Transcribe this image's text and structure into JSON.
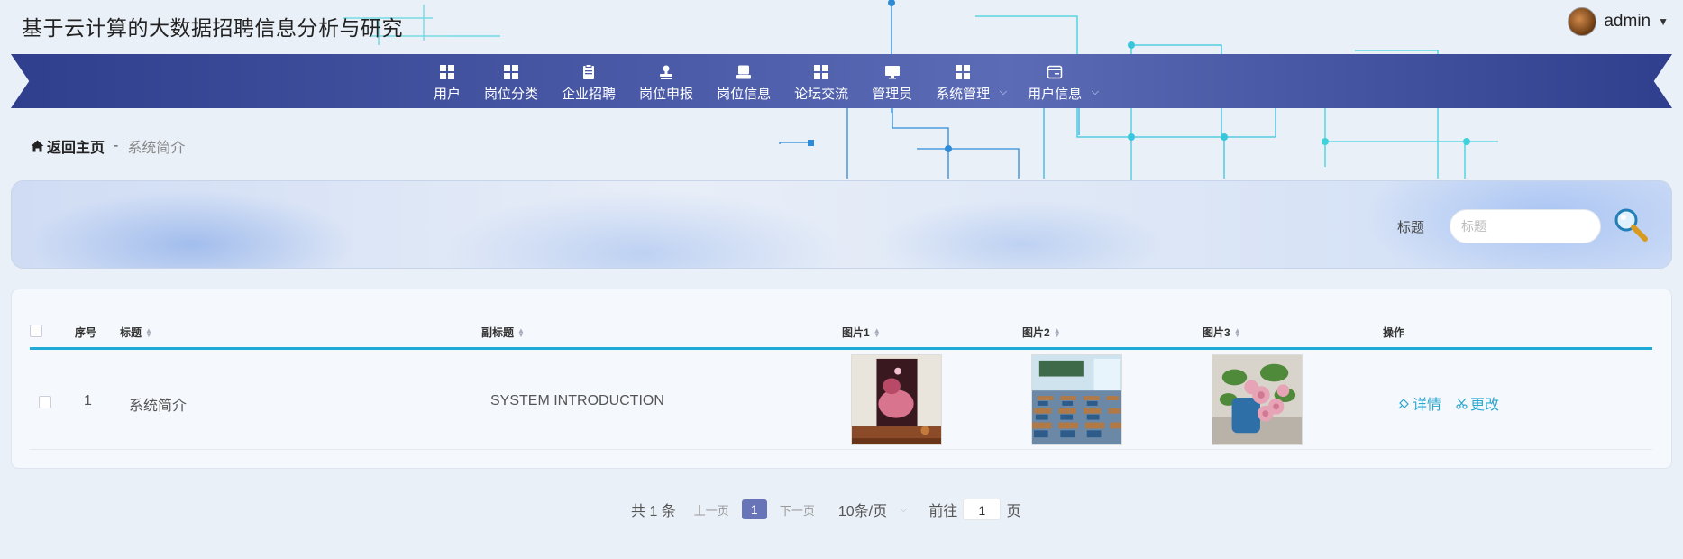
{
  "app": {
    "title": "基于云计算的大数据招聘信息分析与研究"
  },
  "user": {
    "name": "admin"
  },
  "nav": {
    "items": [
      {
        "label": "用户",
        "icon": "grid-icon"
      },
      {
        "label": "岗位分类",
        "icon": "grid-icon"
      },
      {
        "label": "企业招聘",
        "icon": "clipboard-icon"
      },
      {
        "label": "岗位申报",
        "icon": "stamp-icon"
      },
      {
        "label": "岗位信息",
        "icon": "inbox-icon"
      },
      {
        "label": "论坛交流",
        "icon": "grid-icon"
      },
      {
        "label": "管理员",
        "icon": "monitor-icon"
      },
      {
        "label": "系统管理",
        "icon": "grid-icon",
        "dropdown": true
      },
      {
        "label": "用户信息",
        "icon": "card-icon",
        "dropdown": true
      }
    ]
  },
  "breadcrumb": {
    "home": "返回主页",
    "separator": "-",
    "current": "系统简介"
  },
  "search": {
    "label": "标题",
    "placeholder": "标题"
  },
  "table": {
    "headers": {
      "index": "序号",
      "title": "标题",
      "subtitle": "副标题",
      "pic1": "图片1",
      "pic2": "图片2",
      "pic3": "图片3",
      "actions": "操作"
    },
    "rows": [
      {
        "index": "1",
        "title": "系统简介",
        "subtitle": "SYSTEM INTRODUCTION",
        "detail": "详情",
        "edit": "更改"
      }
    ]
  },
  "pagination": {
    "total": "共 1 条",
    "prev": "上一页",
    "page": "1",
    "next": "下一页",
    "page_size": "10条/页",
    "goto_prefix": "前往",
    "goto_value": "1",
    "goto_suffix": "页"
  },
  "colors": {
    "nav": "#3f4f9d",
    "accent": "#1ea9d6",
    "active_page": "#6775b8"
  }
}
